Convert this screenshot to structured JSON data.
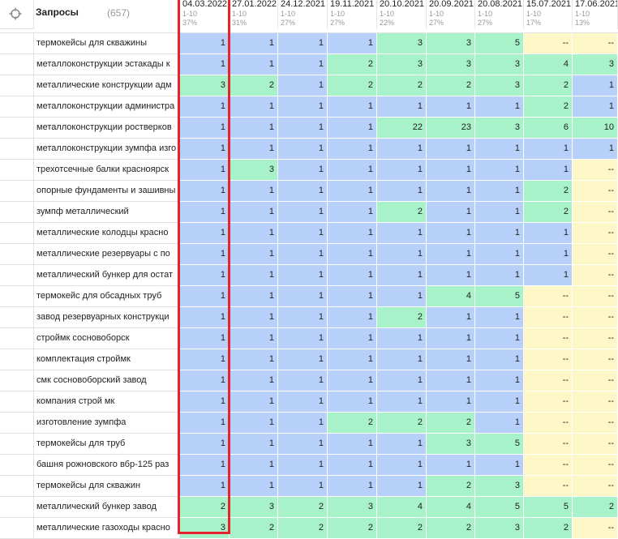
{
  "header": {
    "title": "Запросы",
    "count": "(657)",
    "target_icon": "crosshair-icon"
  },
  "columns": [
    {
      "date": "04.03.2022",
      "range": "1-10",
      "pct": "37%"
    },
    {
      "date": "27.01.2022",
      "range": "1-10",
      "pct": "31%"
    },
    {
      "date": "24.12.2021",
      "range": "1-10",
      "pct": "27%"
    },
    {
      "date": "19.11.2021",
      "range": "1-10",
      "pct": "27%"
    },
    {
      "date": "20.10.2021",
      "range": "1-10",
      "pct": "22%"
    },
    {
      "date": "20.09.2021",
      "range": "1-10",
      "pct": "27%"
    },
    {
      "date": "20.08.2021",
      "range": "1-10",
      "pct": "27%"
    },
    {
      "date": "15.07.2021",
      "range": "1-10",
      "pct": "17%"
    },
    {
      "date": "17.06.2021",
      "range": "1-10",
      "pct": "13%"
    }
  ],
  "rows": [
    {
      "query": "термокейсы для скважины",
      "positions": [
        "1",
        "1",
        "1",
        "1",
        "3",
        "3",
        "5",
        "--",
        "--"
      ],
      "colors": [
        "b",
        "b",
        "b",
        "b",
        "g",
        "g",
        "g",
        "y",
        "y"
      ]
    },
    {
      "query": "металлоконструкции эстакады к",
      "positions": [
        "1",
        "1",
        "1",
        "2",
        "3",
        "3",
        "3",
        "4",
        "3"
      ],
      "colors": [
        "b",
        "b",
        "b",
        "g",
        "g",
        "g",
        "g",
        "g",
        "g"
      ]
    },
    {
      "query": "металлические конструкции адм",
      "positions": [
        "3",
        "2",
        "1",
        "2",
        "2",
        "2",
        "3",
        "2",
        "1"
      ],
      "colors": [
        "g",
        "g",
        "b",
        "g",
        "g",
        "g",
        "g",
        "g",
        "b"
      ]
    },
    {
      "query": "металлоконструкции администра",
      "positions": [
        "1",
        "1",
        "1",
        "1",
        "1",
        "1",
        "1",
        "2",
        "1"
      ],
      "colors": [
        "b",
        "b",
        "b",
        "b",
        "b",
        "b",
        "b",
        "g",
        "b"
      ]
    },
    {
      "query": "металлоконструкции ростверков",
      "positions": [
        "1",
        "1",
        "1",
        "1",
        "22",
        "23",
        "3",
        "6",
        "10"
      ],
      "colors": [
        "b",
        "b",
        "b",
        "b",
        "g",
        "g",
        "g",
        "g",
        "g"
      ]
    },
    {
      "query": "металлоконструкции зумпфа изго",
      "positions": [
        "1",
        "1",
        "1",
        "1",
        "1",
        "1",
        "1",
        "1",
        "1"
      ],
      "colors": [
        "b",
        "b",
        "b",
        "b",
        "b",
        "b",
        "b",
        "b",
        "b"
      ]
    },
    {
      "query": "трехотсечные балки красноярск",
      "positions": [
        "1",
        "3",
        "1",
        "1",
        "1",
        "1",
        "1",
        "1",
        "--"
      ],
      "colors": [
        "b",
        "g",
        "b",
        "b",
        "b",
        "b",
        "b",
        "b",
        "y"
      ]
    },
    {
      "query": "опорные фундаменты и зашивны",
      "positions": [
        "1",
        "1",
        "1",
        "1",
        "1",
        "1",
        "1",
        "2",
        "--"
      ],
      "colors": [
        "b",
        "b",
        "b",
        "b",
        "b",
        "b",
        "b",
        "g",
        "y"
      ]
    },
    {
      "query": "зумпф металлический",
      "positions": [
        "1",
        "1",
        "1",
        "1",
        "2",
        "1",
        "1",
        "2",
        "--"
      ],
      "colors": [
        "b",
        "b",
        "b",
        "b",
        "g",
        "b",
        "b",
        "g",
        "y"
      ]
    },
    {
      "query": "металлические колодцы красно",
      "positions": [
        "1",
        "1",
        "1",
        "1",
        "1",
        "1",
        "1",
        "1",
        "--"
      ],
      "colors": [
        "b",
        "b",
        "b",
        "b",
        "b",
        "b",
        "b",
        "b",
        "y"
      ]
    },
    {
      "query": "металлические резервуары с по",
      "positions": [
        "1",
        "1",
        "1",
        "1",
        "1",
        "1",
        "1",
        "1",
        "--"
      ],
      "colors": [
        "b",
        "b",
        "b",
        "b",
        "b",
        "b",
        "b",
        "b",
        "y"
      ]
    },
    {
      "query": "металлический бункер для остат",
      "positions": [
        "1",
        "1",
        "1",
        "1",
        "1",
        "1",
        "1",
        "1",
        "--"
      ],
      "colors": [
        "b",
        "b",
        "b",
        "b",
        "b",
        "b",
        "b",
        "b",
        "y"
      ]
    },
    {
      "query": "термокейс для обсадных труб",
      "positions": [
        "1",
        "1",
        "1",
        "1",
        "1",
        "4",
        "5",
        "--",
        "--"
      ],
      "colors": [
        "b",
        "b",
        "b",
        "b",
        "b",
        "g",
        "g",
        "y",
        "y"
      ]
    },
    {
      "query": "завод резервуарных конструкци",
      "positions": [
        "1",
        "1",
        "1",
        "1",
        "2",
        "1",
        "1",
        "--",
        "--"
      ],
      "colors": [
        "b",
        "b",
        "b",
        "b",
        "g",
        "b",
        "b",
        "y",
        "y"
      ]
    },
    {
      "query": "строймк сосновоборск",
      "positions": [
        "1",
        "1",
        "1",
        "1",
        "1",
        "1",
        "1",
        "--",
        "--"
      ],
      "colors": [
        "b",
        "b",
        "b",
        "b",
        "b",
        "b",
        "b",
        "y",
        "y"
      ]
    },
    {
      "query": "комплектация строймк",
      "positions": [
        "1",
        "1",
        "1",
        "1",
        "1",
        "1",
        "1",
        "--",
        "--"
      ],
      "colors": [
        "b",
        "b",
        "b",
        "b",
        "b",
        "b",
        "b",
        "y",
        "y"
      ]
    },
    {
      "query": "смк сосновоборский завод",
      "positions": [
        "1",
        "1",
        "1",
        "1",
        "1",
        "1",
        "1",
        "--",
        "--"
      ],
      "colors": [
        "b",
        "b",
        "b",
        "b",
        "b",
        "b",
        "b",
        "y",
        "y"
      ]
    },
    {
      "query": "компания строй мк",
      "positions": [
        "1",
        "1",
        "1",
        "1",
        "1",
        "1",
        "1",
        "--",
        "--"
      ],
      "colors": [
        "b",
        "b",
        "b",
        "b",
        "b",
        "b",
        "b",
        "y",
        "y"
      ]
    },
    {
      "query": "изготовление зумпфа",
      "positions": [
        "1",
        "1",
        "1",
        "2",
        "2",
        "2",
        "1",
        "--",
        "--"
      ],
      "colors": [
        "b",
        "b",
        "b",
        "g",
        "g",
        "g",
        "b",
        "y",
        "y"
      ]
    },
    {
      "query": "термокейсы для труб",
      "positions": [
        "1",
        "1",
        "1",
        "1",
        "1",
        "3",
        "5",
        "--",
        "--"
      ],
      "colors": [
        "b",
        "b",
        "b",
        "b",
        "b",
        "g",
        "g",
        "y",
        "y"
      ]
    },
    {
      "query": "башня рожновского вбр-125 раз",
      "positions": [
        "1",
        "1",
        "1",
        "1",
        "1",
        "1",
        "1",
        "--",
        "--"
      ],
      "colors": [
        "b",
        "b",
        "b",
        "b",
        "b",
        "b",
        "b",
        "y",
        "y"
      ]
    },
    {
      "query": "термокейсы для скважин",
      "positions": [
        "1",
        "1",
        "1",
        "1",
        "1",
        "2",
        "3",
        "--",
        "--"
      ],
      "colors": [
        "b",
        "b",
        "b",
        "b",
        "b",
        "g",
        "g",
        "y",
        "y"
      ]
    },
    {
      "query": "металлический бункер завод",
      "positions": [
        "2",
        "3",
        "2",
        "3",
        "4",
        "4",
        "5",
        "5",
        "2"
      ],
      "colors": [
        "g",
        "g",
        "g",
        "g",
        "g",
        "g",
        "g",
        "g",
        "g"
      ]
    },
    {
      "query": "металлические газоходы красно",
      "positions": [
        "3",
        "2",
        "2",
        "2",
        "2",
        "2",
        "3",
        "2",
        "--"
      ],
      "colors": [
        "g",
        "g",
        "g",
        "g",
        "g",
        "g",
        "g",
        "g",
        "y"
      ]
    }
  ],
  "colors": {
    "blue": "#b7d0f9",
    "green": "#a8f2c9",
    "yellow": "#fdf6c6",
    "highlight": "#e8232b"
  }
}
